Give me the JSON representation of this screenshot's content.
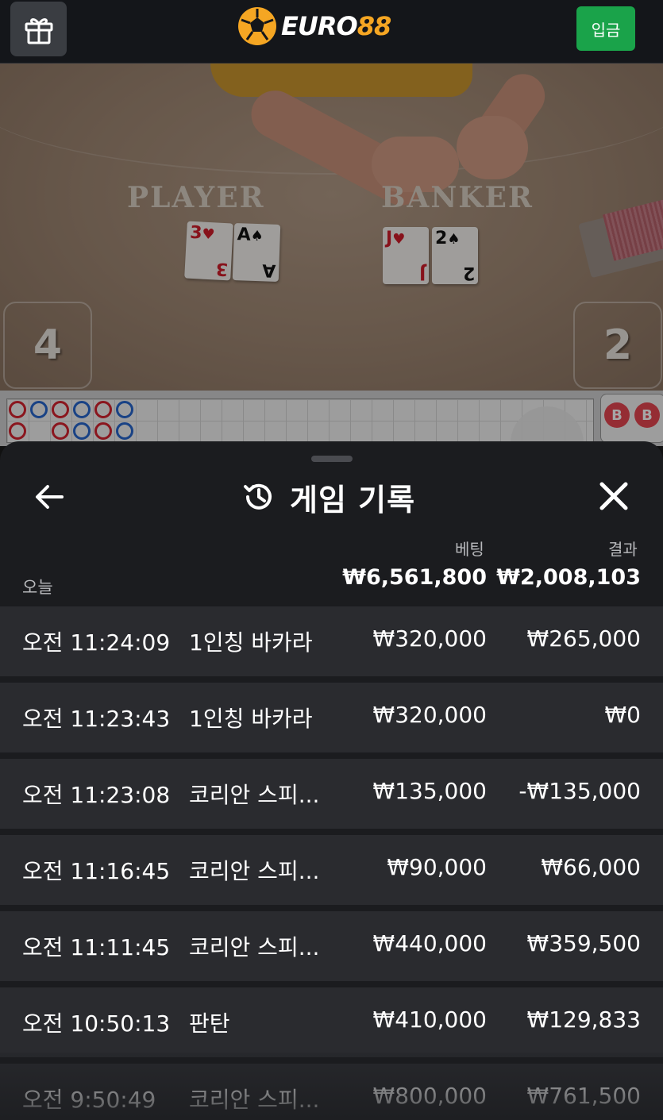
{
  "header": {
    "gift_icon": "gift-icon",
    "logo_euro": "EURO",
    "logo_num": "88",
    "deposit_label": "입금"
  },
  "video": {
    "player_label": "PLAYER",
    "banker_label": "BANKER",
    "player_cards": [
      {
        "rank": "3",
        "suit": "♥",
        "color": "red"
      },
      {
        "rank": "A",
        "suit": "♠",
        "color": "black"
      }
    ],
    "banker_cards": [
      {
        "rank": "J",
        "suit": "♥",
        "color": "red"
      },
      {
        "rank": "2",
        "suit": "♠",
        "color": "black"
      }
    ],
    "player_score": "4",
    "banker_score": "2"
  },
  "roadmap": {
    "bead_labels": [
      "B",
      "B"
    ]
  },
  "sheet": {
    "back_icon": "arrow-left-icon",
    "history_icon": "history-icon",
    "title": "게임 기록",
    "close_icon": "close-icon",
    "col_bet": "베팅",
    "col_result": "결과",
    "today_label": "오늘",
    "total_bet": "₩6,561,800",
    "total_result": "₩2,008,103",
    "rows": [
      {
        "time": "오전 11:24:09",
        "game": "1인칭 바카라",
        "bet": "₩320,000",
        "result": "₩265,000"
      },
      {
        "time": "오전 11:23:43",
        "game": "1인칭 바카라",
        "bet": "₩320,000",
        "result": "₩0"
      },
      {
        "time": "오전 11:23:08",
        "game": "코리안 스피...",
        "bet": "₩135,000",
        "result": "-₩135,000"
      },
      {
        "time": "오전 11:16:45",
        "game": "코리안 스피...",
        "bet": "₩90,000",
        "result": "₩66,000"
      },
      {
        "time": "오전 11:11:45",
        "game": "코리안 스피...",
        "bet": "₩440,000",
        "result": "₩359,500"
      },
      {
        "time": "오전 10:50:13",
        "game": "판탄",
        "bet": "₩410,000",
        "result": "₩129,833"
      },
      {
        "time": "오전 9:50:49",
        "game": "코리안 스피...",
        "bet": "₩800,000",
        "result": "₩761,500"
      }
    ]
  },
  "colors": {
    "brand": "#f5a623",
    "deposit": "#1aa34a",
    "sheet_bg": "#1b1c1f",
    "row_bg": "#2a2b2f"
  }
}
